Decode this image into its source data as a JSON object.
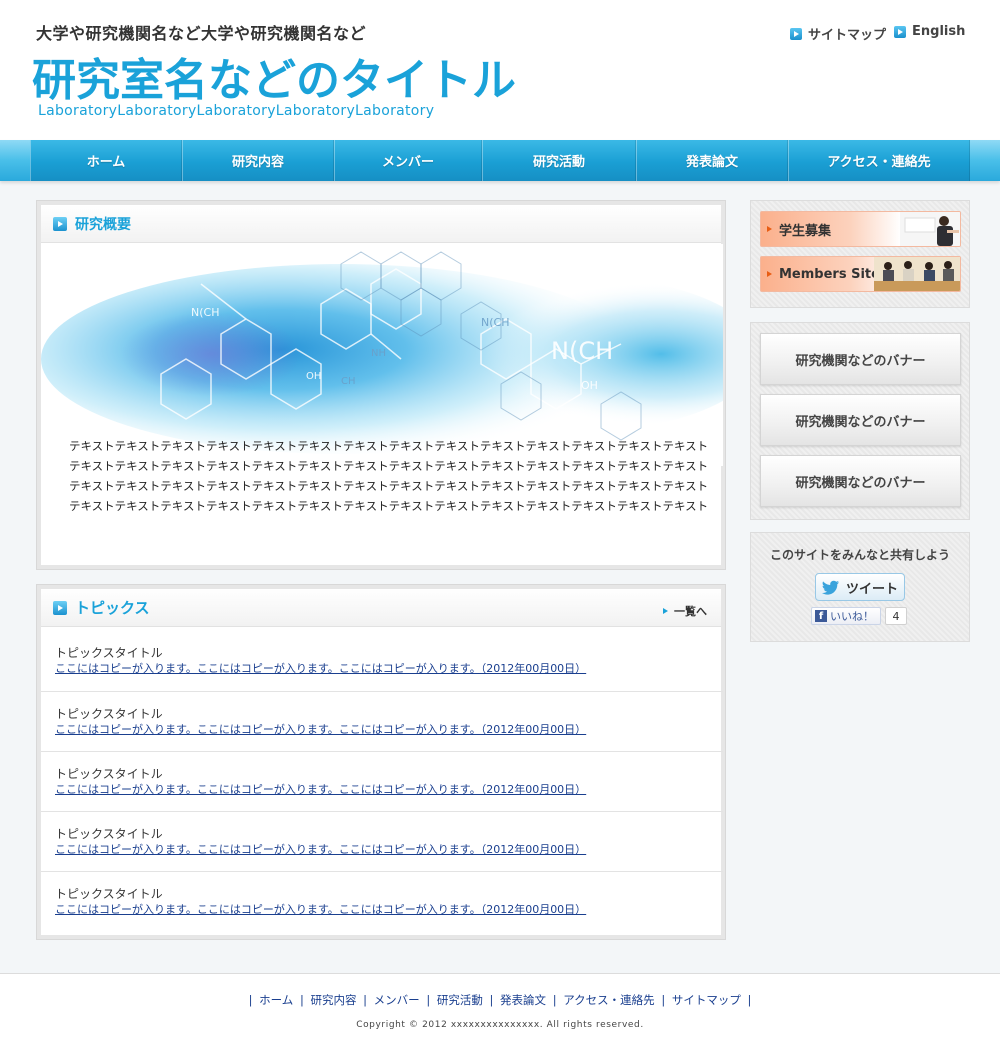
{
  "header": {
    "university": "大学や研究機関名など大学や研究機関名など",
    "lab_title": "研究室名などのタイトル",
    "lab_subtitle": "LaboratoryLaboratoryLaboratoryLaboratoryLaboratory",
    "sitemap_label": "サイトマップ",
    "english_label": "English"
  },
  "nav": {
    "items": [
      {
        "label": "ホーム"
      },
      {
        "label": "研究内容"
      },
      {
        "label": "メンバー"
      },
      {
        "label": "研究活動"
      },
      {
        "label": "発表論文"
      },
      {
        "label": "アクセス・連絡先"
      }
    ]
  },
  "overview": {
    "title": "研究概要",
    "lines": [
      "テキストテキストテキストテキストテキストテキストテキストテキストテキストテキストテキストテキストテキストテキスト",
      "テキストテキストテキストテキストテキストテキストテキストテキストテキストテキストテキストテキストテキストテキスト",
      "テキストテキストテキストテキストテキストテキストテキストテキストテキストテキストテキストテキストテキストテキスト",
      "テキストテキストテキストテキストテキストテキストテキストテキストテキストテキストテキストテキストテキストテキスト"
    ]
  },
  "topics": {
    "title": "トピックス",
    "more_label": "一覧へ",
    "items": [
      {
        "title": "トピックスタイトル",
        "link": "ここにはコピーが入ります。ここにはコピーが入ります。ここにはコピーが入ります。（2012年00月00日）"
      },
      {
        "title": "トピックスタイトル",
        "link": "ここにはコピーが入ります。ここにはコピーが入ります。ここにはコピーが入ります。（2012年00月00日）"
      },
      {
        "title": "トピックスタイトル",
        "link": "ここにはコピーが入ります。ここにはコピーが入ります。ここにはコピーが入ります。（2012年00月00日）"
      },
      {
        "title": "トピックスタイトル",
        "link": "ここにはコピーが入ります。ここにはコピーが入ります。ここにはコピーが入ります。（2012年00月00日）"
      },
      {
        "title": "トピックスタイトル",
        "link": "ここにはコピーが入ります。ここにはコピーが入ります。ここにはコピーが入ります。（2012年00月00日）"
      }
    ]
  },
  "sidebar": {
    "recruit_label": "学生募集",
    "members_label": "Members Site",
    "banners": [
      {
        "label": "研究機関などのバナー"
      },
      {
        "label": "研究機関などのバナー"
      },
      {
        "label": "研究機関などのバナー"
      }
    ],
    "share": {
      "title": "このサイトをみんなと共有しよう",
      "tweet_label": "ツイート",
      "like_label": "いいね！",
      "like_count": "4"
    }
  },
  "footer": {
    "links": [
      "ホーム",
      "研究内容",
      "メンバー",
      "研究活動",
      "発表論文",
      "アクセス・連絡先",
      "サイトマップ"
    ],
    "copyright": "Copyright © 2012 xxxxxxxxxxxxxxx. All rights reserved."
  },
  "colors": {
    "accent": "#1aa2d9",
    "nav": "#1a9fd4",
    "link": "#1a3f8f",
    "recruit_accent": "#e85d14"
  }
}
